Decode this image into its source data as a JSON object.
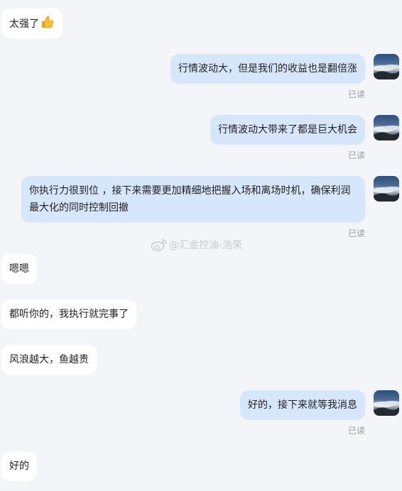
{
  "read_label": "已读",
  "watermark": "@汇金控油-浩荣",
  "messages": [
    {
      "text": "太强了",
      "emoji": "thumbs-up-icon"
    },
    {
      "text": "行情波动大，但是我们的收益也是翻倍涨"
    },
    {
      "text": "行情波动大带来了都是巨大机会"
    },
    {
      "text": "你执行力很到位 ，接下来需要更加精细地把握入场和离场时机，确保利润最大化的同时控制回撤"
    },
    {
      "text": "嗯嗯"
    },
    {
      "text": "都听你的，我执行就完事了"
    },
    {
      "text": "风浪越大，鱼越贵"
    },
    {
      "text": "好的，接下来就等我消息"
    },
    {
      "text": "好的"
    }
  ]
}
